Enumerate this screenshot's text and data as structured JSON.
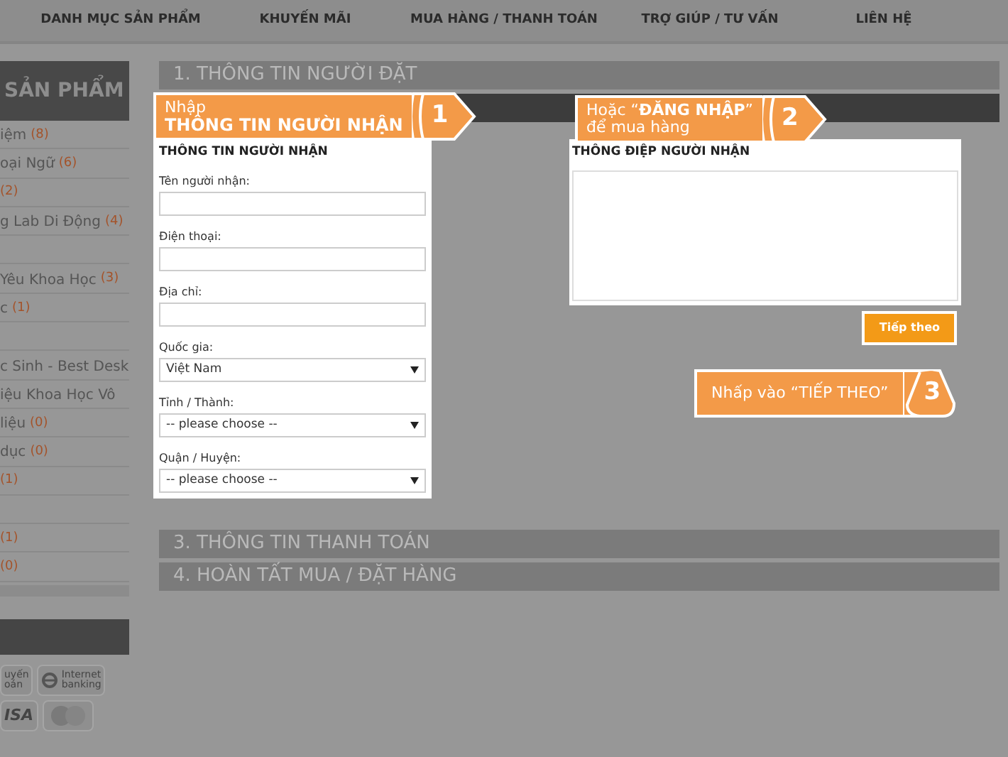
{
  "nav": [
    "DANH MỤC SẢN PHẨM",
    "KHUYẾN MÃI",
    "MUA HÀNG / THANH TOÁN",
    "TRỢ GIÚP / TƯ VẤN",
    "LIÊN HỆ"
  ],
  "sidebar": {
    "title": "SẢN PHẨM",
    "items": [
      {
        "kind": "link",
        "label": "iệm",
        "count": "(8)"
      },
      {
        "kind": "link",
        "label": "oại Ngữ",
        "count": "(6)"
      },
      {
        "kind": "link",
        "count": "(2)"
      },
      {
        "kind": "link",
        "label": "g Lab Di Động",
        "count": "(4)"
      },
      {
        "kind": "spacer"
      },
      {
        "kind": "link",
        "label": "Yêu Khoa Học",
        "count": "(3)"
      },
      {
        "kind": "link",
        "label": "c",
        "count": "(1)"
      },
      {
        "kind": "spacer"
      },
      {
        "kind": "link",
        "label": "c Sinh - Best Desk"
      },
      {
        "kind": "link",
        "label": "iệu Khoa Học Vô"
      },
      {
        "kind": "link",
        "label": "liệu",
        "count": "(0)"
      },
      {
        "kind": "link",
        "label": "dục",
        "count": "(0)"
      },
      {
        "kind": "link",
        "count": "(1)"
      },
      {
        "kind": "spacer"
      },
      {
        "kind": "link",
        "count": "(1)"
      },
      {
        "kind": "link",
        "count": "(0)"
      }
    ],
    "payment": [
      {
        "kind": "transfer",
        "lines": [
          "uyến",
          "oán"
        ]
      },
      {
        "kind": "internet",
        "lines": [
          "Internet",
          "banking"
        ]
      },
      {
        "kind": "visa",
        "lines": [
          "ISA"
        ]
      },
      {
        "kind": "mastercard"
      }
    ]
  },
  "steps_top": [
    {
      "label": "1. THÔNG TIN NGƯỜI ĐẶT",
      "active": false
    },
    {
      "active": true
    }
  ],
  "recipient_form": {
    "title": "THÔNG TIN NGƯỜI NHẬN",
    "fields": [
      {
        "kind": "text",
        "label": "Tên người nhận:"
      },
      {
        "kind": "text",
        "label": "Điện thoại:"
      },
      {
        "kind": "text",
        "label": "Địa chỉ:"
      },
      {
        "kind": "select",
        "label": "Quốc gia:",
        "value": "Việt Nam"
      },
      {
        "kind": "select",
        "label": "Tỉnh / Thành:",
        "value": "-- please choose --"
      },
      {
        "kind": "select",
        "label": "Quận / Huyện:",
        "value": "-- please choose --"
      }
    ]
  },
  "message": {
    "title": "THÔNG ĐIỆP NGƯỜI NHẬN"
  },
  "next_button": "Tiếp theo",
  "steps_bottom": [
    {
      "label": "3. THÔNG TIN THANH TOÁN",
      "active": false
    },
    {
      "label": "4. HOÀN TẤT MUA / ĐẶT HÀNG",
      "active": false
    }
  ],
  "callouts": [
    {
      "number": "1",
      "kind": "arrow-right",
      "line1": "Nhập",
      "line2": "THÔNG TIN NGƯỜI NHẬN"
    },
    {
      "number": "2",
      "kind": "arrow-right",
      "line1": "Hoặc “**ĐĂNG NHẬP**”",
      "line2": "để mua hàng"
    },
    {
      "number": "3",
      "kind": "arrow-up",
      "line1": "Nhấp vào “TIẾP THEO”"
    }
  ]
}
